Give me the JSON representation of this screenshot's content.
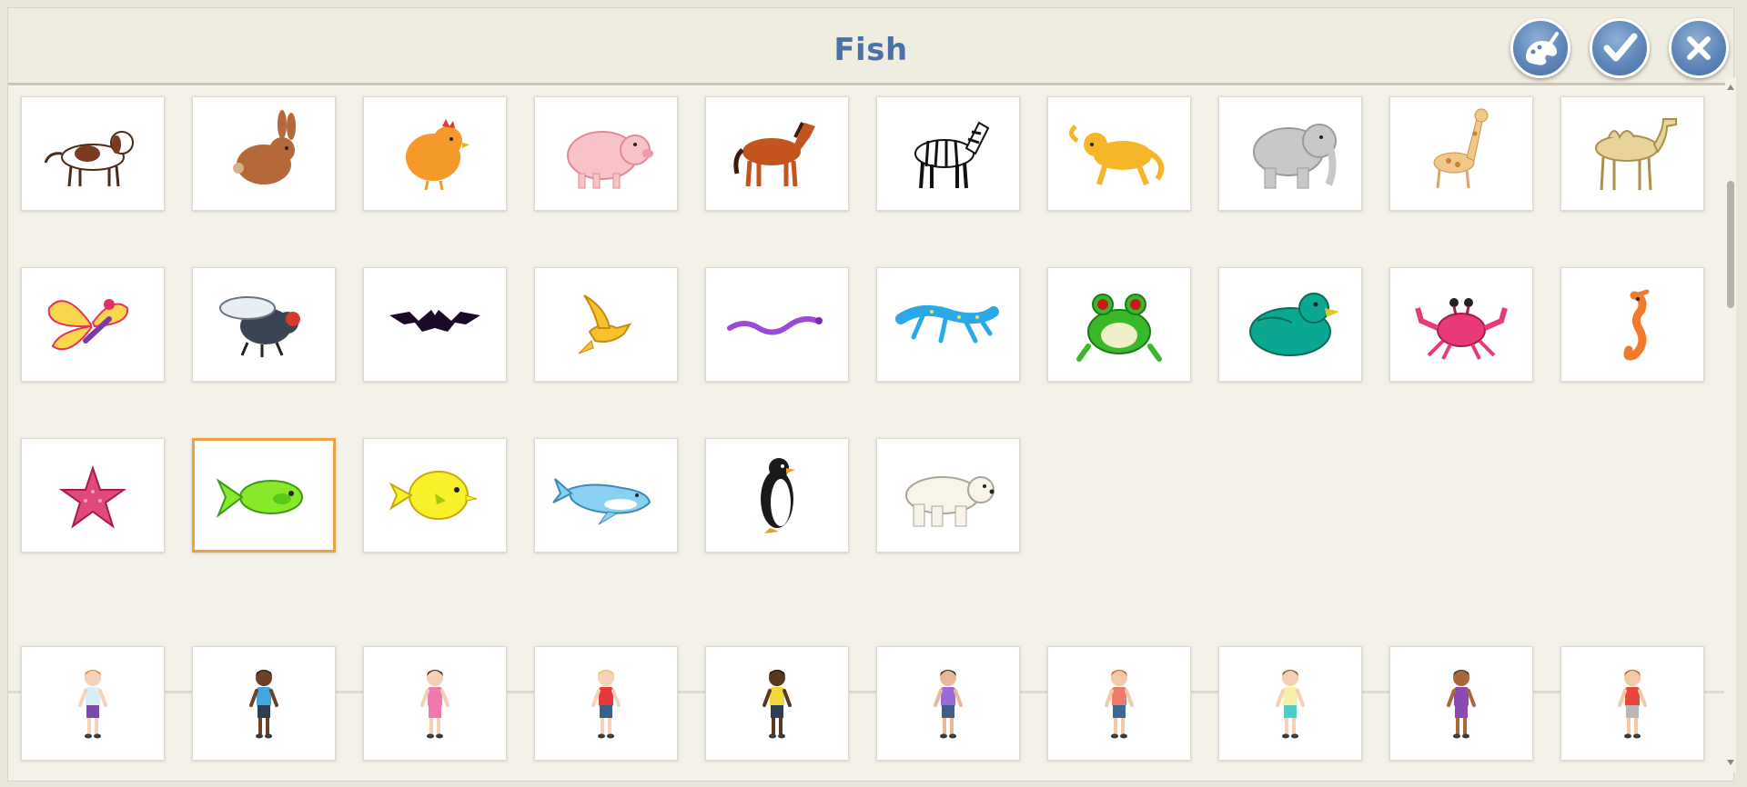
{
  "header": {
    "title": "Fish",
    "buttons": [
      {
        "name": "paint-button",
        "icon": "paintbrush-icon"
      },
      {
        "name": "confirm-button",
        "icon": "checkmark-icon"
      },
      {
        "name": "close-button",
        "icon": "close-icon"
      }
    ]
  },
  "colors": {
    "title": "#4a72a8",
    "button": "#5e86b8",
    "selected_border": "#f0a040"
  },
  "animals": [
    {
      "name": "dog",
      "selected": false
    },
    {
      "name": "rabbit",
      "selected": false
    },
    {
      "name": "chick",
      "selected": false
    },
    {
      "name": "pig",
      "selected": false
    },
    {
      "name": "horse",
      "selected": false
    },
    {
      "name": "zebra",
      "selected": false
    },
    {
      "name": "monkey",
      "selected": false
    },
    {
      "name": "elephant",
      "selected": false
    },
    {
      "name": "giraffe",
      "selected": false
    },
    {
      "name": "camel",
      "selected": false
    },
    {
      "name": "butterfly",
      "selected": false
    },
    {
      "name": "fly",
      "selected": false
    },
    {
      "name": "bat",
      "selected": false
    },
    {
      "name": "bird",
      "selected": false
    },
    {
      "name": "snake",
      "selected": false
    },
    {
      "name": "lizard",
      "selected": false
    },
    {
      "name": "frog",
      "selected": false
    },
    {
      "name": "duck",
      "selected": false
    },
    {
      "name": "crab",
      "selected": false
    },
    {
      "name": "seahorse",
      "selected": false
    },
    {
      "name": "starfish",
      "selected": false
    },
    {
      "name": "green-fish",
      "selected": true
    },
    {
      "name": "yellow-fish",
      "selected": false
    },
    {
      "name": "whale",
      "selected": false
    },
    {
      "name": "penguin",
      "selected": false
    },
    {
      "name": "polar-bear",
      "selected": false
    }
  ],
  "people": [
    {
      "name": "girl-red-hair",
      "skin": "#f6d3b8",
      "hair": "#e8813a",
      "shirt": "#d7eef8",
      "bottom": "#7b4aa8"
    },
    {
      "name": "girl-blue-shirt",
      "skin": "#6b4227",
      "hair": "#2a1a10",
      "shirt": "#3fa7dd",
      "bottom": "#2c3f55"
    },
    {
      "name": "girl-pink-dress",
      "skin": "#f4d1b5",
      "hair": "#4a2e1c",
      "shirt": "#f07ab0",
      "bottom": "#f07ab0"
    },
    {
      "name": "boy-red-shirt",
      "skin": "#f6d3b8",
      "hair": "#f0c24a",
      "shirt": "#e8383a",
      "bottom": "#3b5f88"
    },
    {
      "name": "boy-yellow-shirt",
      "skin": "#5a3820",
      "hair": "#1a1008",
      "shirt": "#f2d63a",
      "bottom": "#2c3f55"
    },
    {
      "name": "boy-purple-shirt",
      "skin": "#e8b998",
      "hair": "#4a2e1c",
      "shirt": "#9a6ad8",
      "bottom": "#3b5f88"
    },
    {
      "name": "boy-red-hair",
      "skin": "#f4c9a8",
      "hair": "#d8602a",
      "shirt": "#f07a6a",
      "bottom": "#3b6a98"
    },
    {
      "name": "girl-yellow-top",
      "skin": "#f4d1b5",
      "hair": "#8a5a30",
      "shirt": "#f6f0a8",
      "bottom": "#4ad0c8"
    },
    {
      "name": "girl-purple-top",
      "skin": "#a8683a",
      "hair": "#5a3218",
      "shirt": "#8a4ab0",
      "bottom": "#8a4ab0"
    },
    {
      "name": "boy-grey-shorts",
      "skin": "#f4c9a8",
      "hair": "#c8602a",
      "shirt": "#e8483a",
      "bottom": "#b8b8b8"
    }
  ]
}
